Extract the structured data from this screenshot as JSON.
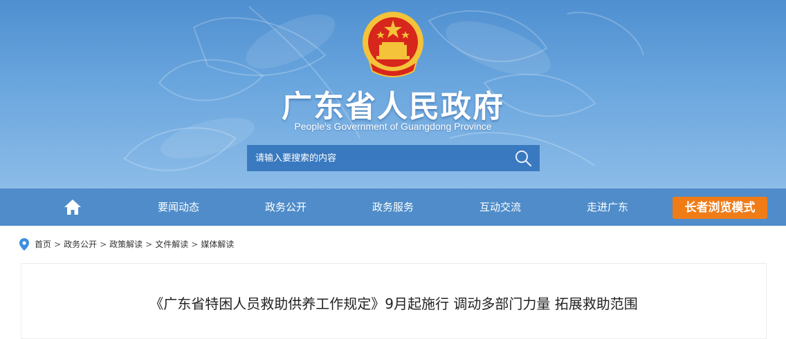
{
  "header": {
    "title": "广东省人民政府",
    "subtitle": "People's Government of Guangdong Province",
    "search": {
      "placeholder": "请输入要搜索的内容",
      "icon": "search-icon"
    }
  },
  "nav": {
    "home_icon": "home-icon",
    "items": [
      {
        "label": "要闻动态"
      },
      {
        "label": "政务公开"
      },
      {
        "label": "政务服务"
      },
      {
        "label": "互动交流"
      },
      {
        "label": "走进广东"
      }
    ],
    "elder_mode": "长者浏览模式"
  },
  "breadcrumb": {
    "icon": "location-pin-icon",
    "items": [
      "首页",
      "政务公开",
      "政策解读",
      "文件解读",
      "媒体解读"
    ],
    "separator": ">"
  },
  "article": {
    "title": "《广东省特困人员救助供养工作规定》9月起施行 调动多部门力量 拓展救助范围"
  },
  "colors": {
    "header_blue": "#4f8fd0",
    "nav_blue": "#4f8cc9",
    "elder_orange": "#f07c17",
    "emblem_red": "#d7261c",
    "emblem_gold": "#f4c33a"
  }
}
